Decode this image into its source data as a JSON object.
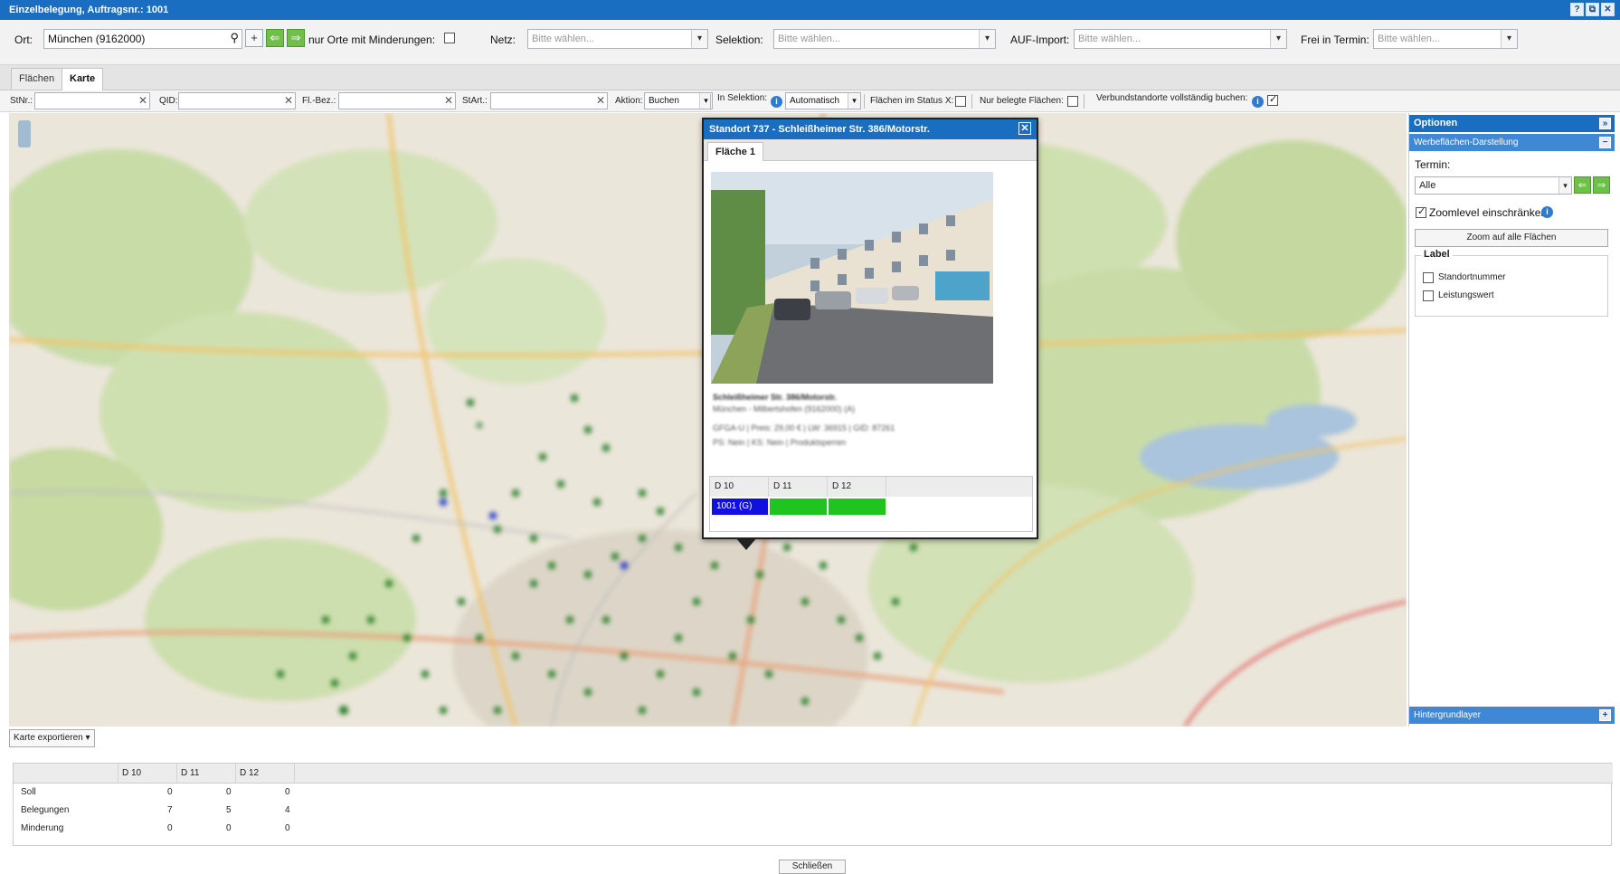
{
  "window": {
    "title": "Einzelbelegung, Auftragsnr.: 1001",
    "controls": [
      "?",
      "⧉",
      "✕"
    ]
  },
  "filters": {
    "ort_label": "Ort:",
    "ort_value": "München (9162000)",
    "nur_orte_label": "nur Orte mit Minderungen:",
    "netz_label": "Netz:",
    "netz_placeholder": "Bitte wählen...",
    "selektion_label": "Selektion:",
    "selektion_placeholder": "Bitte wählen...",
    "auf_import_label": "AUF-Import:",
    "auf_import_placeholder": "Bitte wählen...",
    "frei_label": "Frei in Termin:",
    "frei_placeholder": "Bitte wählen..."
  },
  "tabs": [
    "Flächen",
    "Karte"
  ],
  "toolbar": {
    "stnr_label": "StNr.:",
    "qid_label": "QID:",
    "flbez_label": "Fl.-Bez.:",
    "start_label": "StArt.:",
    "aktion_label": "Aktion:",
    "aktion_value": "Buchen",
    "in_selektion_label": "In Selektion:",
    "in_selektion_value": "Automatisch",
    "status_x_label": "Flächen im Status X:",
    "nur_belegte_label": "Nur belegte Flächen:",
    "verbund_label": "Verbundstandorte vollständig buchen:"
  },
  "popup": {
    "title": "Standort 737 - Schleißheimer Str. 386/Motorstr.",
    "tab": "Fläche 1",
    "address": "Schleißheimer Str. 386/Motorstr.",
    "location": "München - Milbertshofen (9162000) (A)",
    "details1": "GFGA-U | Preis: 29,00 € | LW: 36915 | GID: 87261",
    "details2": "PS: Nein | KS: Nein | Produktsperren",
    "grid_headers": [
      "D 10",
      "D 11",
      "D 12"
    ],
    "grid_first_cell": "1001 (G)",
    "colors": {
      "booked": "#1010e0",
      "free": "#1fc41f"
    }
  },
  "panel": {
    "header": "Optionen",
    "section": "Werbeflächen-Darstellung",
    "termin_label": "Termin:",
    "termin_value": "Alle",
    "zoom_restrict_label": "Zoomlevel einschränken",
    "zoom_btn": "Zoom auf alle Flächen",
    "label_legend": "Label",
    "label_options": [
      "Standortnummer",
      "Leistungswert"
    ],
    "footer": "Hintergrundlayer"
  },
  "export_label": "Karte exportieren",
  "stats": {
    "headers": [
      "D 10",
      "D 11",
      "D 12"
    ],
    "rows": [
      {
        "label": "Soll",
        "values": [
          0,
          0,
          0
        ]
      },
      {
        "label": "Belegungen",
        "values": [
          7,
          5,
          4
        ]
      },
      {
        "label": "Minderung",
        "values": [
          0,
          0,
          0
        ]
      }
    ]
  },
  "close_label": "Schließen"
}
